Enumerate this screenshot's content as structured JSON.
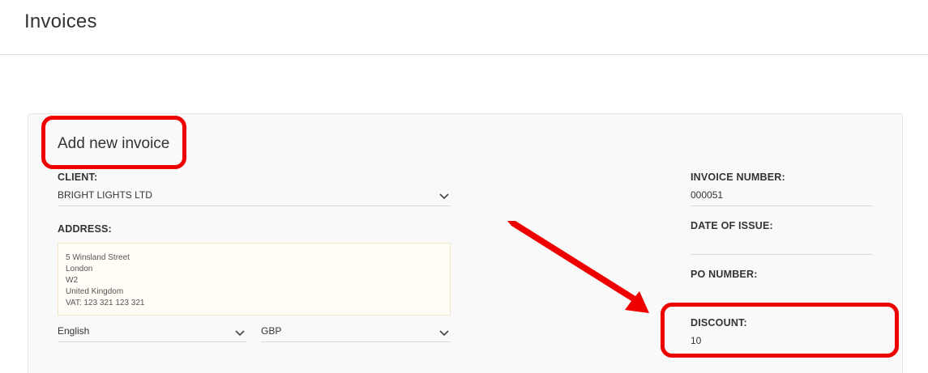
{
  "header": {
    "title": "Invoices"
  },
  "form": {
    "title": "Add new invoice",
    "client": {
      "label": "CLIENT:",
      "value": "BRIGHT LIGHTS LTD"
    },
    "address": {
      "label": "ADDRESS:",
      "lines": [
        "5 Winsland Street",
        "London",
        "W2",
        "United Kingdom",
        "VAT: 123 321 123 321"
      ]
    },
    "language": {
      "value": "English"
    },
    "currency": {
      "value": "GBP"
    },
    "invoice_number": {
      "label": "INVOICE NUMBER:",
      "value": "000051"
    },
    "date_of_issue": {
      "label": "DATE OF ISSUE:",
      "value": ""
    },
    "po_number": {
      "label": "PO NUMBER:",
      "value": ""
    },
    "discount": {
      "label": "DISCOUNT:",
      "value": "10"
    }
  },
  "annotation": {
    "highlight_color": "#ee0000"
  }
}
